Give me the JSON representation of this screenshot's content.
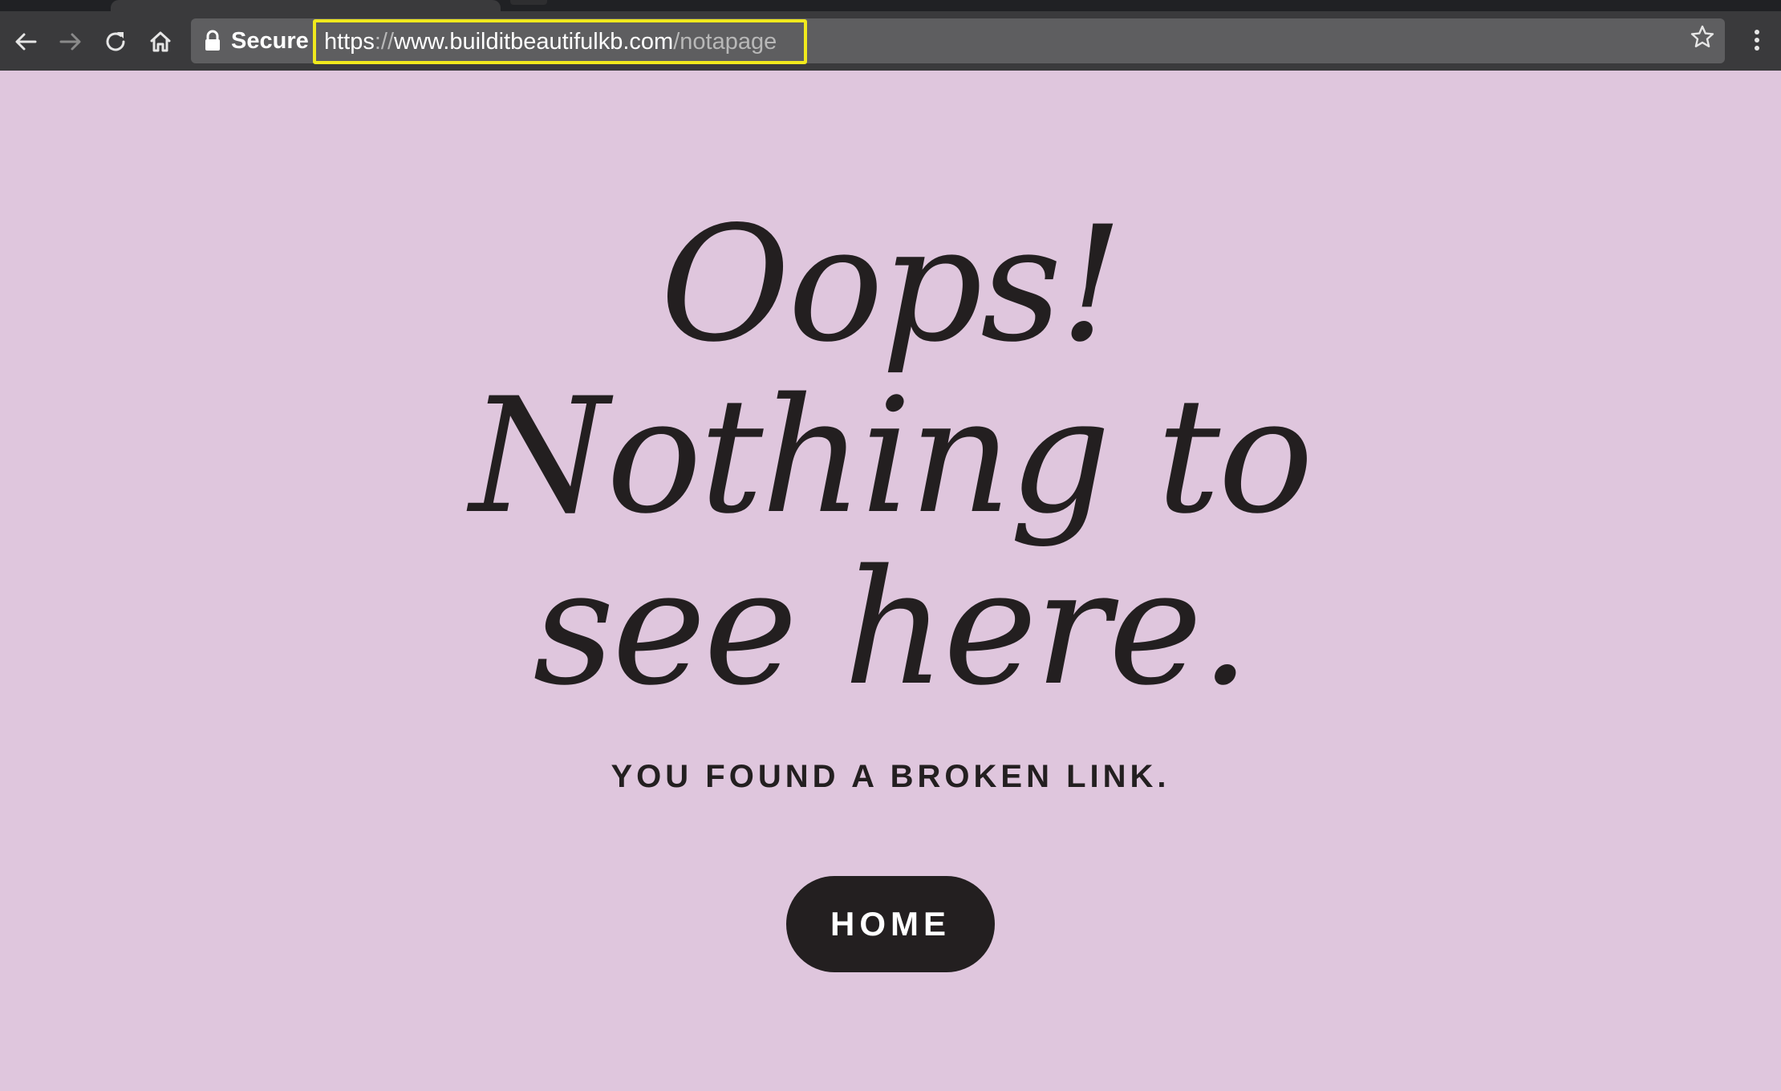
{
  "browser": {
    "secure_label": "Secure",
    "url": {
      "scheme": "https",
      "separator": "://",
      "host": "www.builditbeautifulkb.com",
      "path": "/notapage"
    },
    "icons": {
      "back": "arrow-left-icon",
      "forward": "arrow-right-icon",
      "reload": "reload-icon",
      "home": "home-icon",
      "lock": "lock-icon",
      "bookmark": "star-icon",
      "menu": "kebab-menu-icon"
    },
    "highlight_color": "#f0e91d"
  },
  "page": {
    "headline_lines": [
      "Oops!",
      "Nothing to",
      "see here."
    ],
    "subtitle": "YOU FOUND A BROKEN LINK.",
    "home_button_label": "HOME",
    "colors": {
      "background": "#dfc6dd",
      "text": "#231f20",
      "button_bg": "#231f20",
      "button_text": "#ffffff"
    }
  }
}
